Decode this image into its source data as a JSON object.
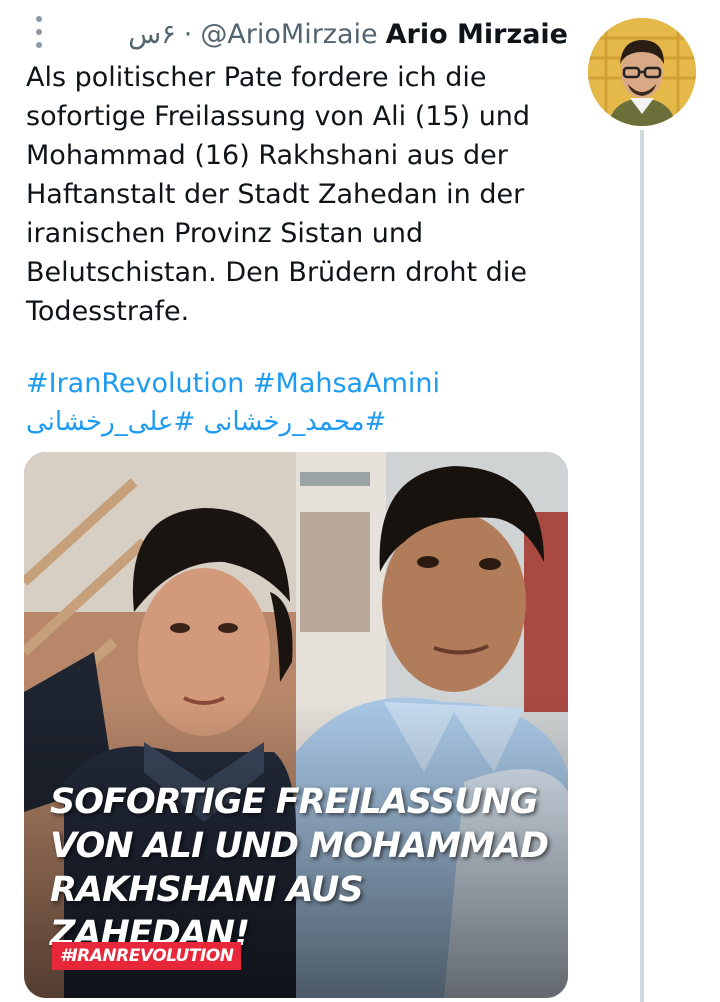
{
  "tweet": {
    "author_name": "Ario Mirzaie",
    "handle": "@ArioMirzaie",
    "separator": "·",
    "time": "۶س",
    "avatar_icon": "profile-photo",
    "more_icon": "more-vertical-icon",
    "text": "Als politischer Pate fordere ich die sofortige Freilassung von Ali (15) und Mohammad (16) Rakhshani aus der Haftanstalt der Stadt Zahedan in der iranischen Provinz Sistan und Belutschistan. Den Brüdern droht die Todesstrafe.",
    "hashtags": "#IranRevolution #MahsaAmini",
    "hashtags_fa": "#محمد_رخشانی #علی_رخشانی",
    "link_color": "#1d9bf0"
  },
  "media": {
    "overlay_lines": [
      "SOFORTIGE FREILASSUNG",
      "VON ALI UND MOHAMMAD",
      "RAKHSHANI AUS ZAHEDAN!"
    ],
    "badge": "#IRANREVOLUTION",
    "badge_color": "#e8273a"
  }
}
